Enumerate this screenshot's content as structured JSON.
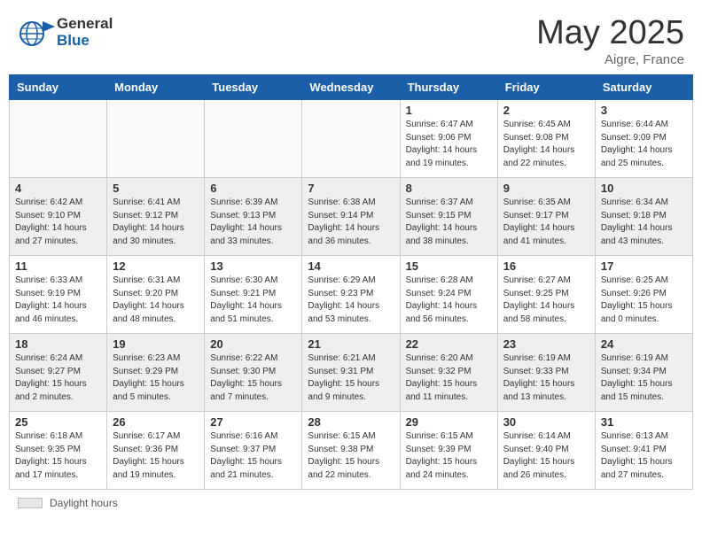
{
  "header": {
    "logo_general": "General",
    "logo_blue": "Blue",
    "month_year": "May 2025",
    "location": "Aigre, France"
  },
  "days_of_week": [
    "Sunday",
    "Monday",
    "Tuesday",
    "Wednesday",
    "Thursday",
    "Friday",
    "Saturday"
  ],
  "weeks": [
    [
      {
        "num": "",
        "info": ""
      },
      {
        "num": "",
        "info": ""
      },
      {
        "num": "",
        "info": ""
      },
      {
        "num": "",
        "info": ""
      },
      {
        "num": "1",
        "info": "Sunrise: 6:47 AM\nSunset: 9:06 PM\nDaylight: 14 hours\nand 19 minutes."
      },
      {
        "num": "2",
        "info": "Sunrise: 6:45 AM\nSunset: 9:08 PM\nDaylight: 14 hours\nand 22 minutes."
      },
      {
        "num": "3",
        "info": "Sunrise: 6:44 AM\nSunset: 9:09 PM\nDaylight: 14 hours\nand 25 minutes."
      }
    ],
    [
      {
        "num": "4",
        "info": "Sunrise: 6:42 AM\nSunset: 9:10 PM\nDaylight: 14 hours\nand 27 minutes."
      },
      {
        "num": "5",
        "info": "Sunrise: 6:41 AM\nSunset: 9:12 PM\nDaylight: 14 hours\nand 30 minutes."
      },
      {
        "num": "6",
        "info": "Sunrise: 6:39 AM\nSunset: 9:13 PM\nDaylight: 14 hours\nand 33 minutes."
      },
      {
        "num": "7",
        "info": "Sunrise: 6:38 AM\nSunset: 9:14 PM\nDaylight: 14 hours\nand 36 minutes."
      },
      {
        "num": "8",
        "info": "Sunrise: 6:37 AM\nSunset: 9:15 PM\nDaylight: 14 hours\nand 38 minutes."
      },
      {
        "num": "9",
        "info": "Sunrise: 6:35 AM\nSunset: 9:17 PM\nDaylight: 14 hours\nand 41 minutes."
      },
      {
        "num": "10",
        "info": "Sunrise: 6:34 AM\nSunset: 9:18 PM\nDaylight: 14 hours\nand 43 minutes."
      }
    ],
    [
      {
        "num": "11",
        "info": "Sunrise: 6:33 AM\nSunset: 9:19 PM\nDaylight: 14 hours\nand 46 minutes."
      },
      {
        "num": "12",
        "info": "Sunrise: 6:31 AM\nSunset: 9:20 PM\nDaylight: 14 hours\nand 48 minutes."
      },
      {
        "num": "13",
        "info": "Sunrise: 6:30 AM\nSunset: 9:21 PM\nDaylight: 14 hours\nand 51 minutes."
      },
      {
        "num": "14",
        "info": "Sunrise: 6:29 AM\nSunset: 9:23 PM\nDaylight: 14 hours\nand 53 minutes."
      },
      {
        "num": "15",
        "info": "Sunrise: 6:28 AM\nSunset: 9:24 PM\nDaylight: 14 hours\nand 56 minutes."
      },
      {
        "num": "16",
        "info": "Sunrise: 6:27 AM\nSunset: 9:25 PM\nDaylight: 14 hours\nand 58 minutes."
      },
      {
        "num": "17",
        "info": "Sunrise: 6:25 AM\nSunset: 9:26 PM\nDaylight: 15 hours\nand 0 minutes."
      }
    ],
    [
      {
        "num": "18",
        "info": "Sunrise: 6:24 AM\nSunset: 9:27 PM\nDaylight: 15 hours\nand 2 minutes."
      },
      {
        "num": "19",
        "info": "Sunrise: 6:23 AM\nSunset: 9:29 PM\nDaylight: 15 hours\nand 5 minutes."
      },
      {
        "num": "20",
        "info": "Sunrise: 6:22 AM\nSunset: 9:30 PM\nDaylight: 15 hours\nand 7 minutes."
      },
      {
        "num": "21",
        "info": "Sunrise: 6:21 AM\nSunset: 9:31 PM\nDaylight: 15 hours\nand 9 minutes."
      },
      {
        "num": "22",
        "info": "Sunrise: 6:20 AM\nSunset: 9:32 PM\nDaylight: 15 hours\nand 11 minutes."
      },
      {
        "num": "23",
        "info": "Sunrise: 6:19 AM\nSunset: 9:33 PM\nDaylight: 15 hours\nand 13 minutes."
      },
      {
        "num": "24",
        "info": "Sunrise: 6:19 AM\nSunset: 9:34 PM\nDaylight: 15 hours\nand 15 minutes."
      }
    ],
    [
      {
        "num": "25",
        "info": "Sunrise: 6:18 AM\nSunset: 9:35 PM\nDaylight: 15 hours\nand 17 minutes."
      },
      {
        "num": "26",
        "info": "Sunrise: 6:17 AM\nSunset: 9:36 PM\nDaylight: 15 hours\nand 19 minutes."
      },
      {
        "num": "27",
        "info": "Sunrise: 6:16 AM\nSunset: 9:37 PM\nDaylight: 15 hours\nand 21 minutes."
      },
      {
        "num": "28",
        "info": "Sunrise: 6:15 AM\nSunset: 9:38 PM\nDaylight: 15 hours\nand 22 minutes."
      },
      {
        "num": "29",
        "info": "Sunrise: 6:15 AM\nSunset: 9:39 PM\nDaylight: 15 hours\nand 24 minutes."
      },
      {
        "num": "30",
        "info": "Sunrise: 6:14 AM\nSunset: 9:40 PM\nDaylight: 15 hours\nand 26 minutes."
      },
      {
        "num": "31",
        "info": "Sunrise: 6:13 AM\nSunset: 9:41 PM\nDaylight: 15 hours\nand 27 minutes."
      }
    ]
  ],
  "footer": {
    "daylight_label": "Daylight hours"
  }
}
